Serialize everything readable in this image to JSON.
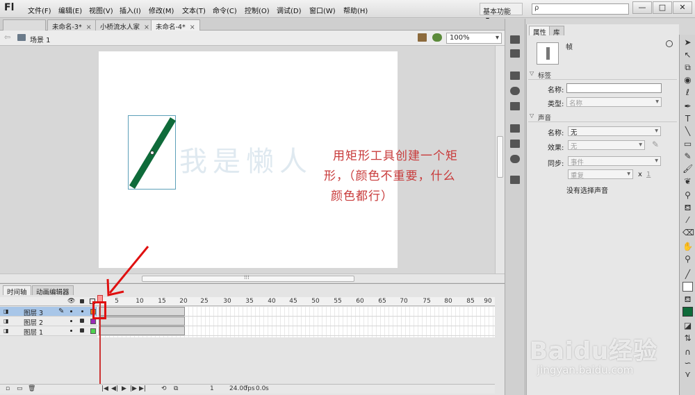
{
  "app": {
    "logo": "Fl"
  },
  "menu": [
    "文件(F)",
    "编辑(E)",
    "视图(V)",
    "插入(I)",
    "修改(M)",
    "文本(T)",
    "命令(C)",
    "控制(O)",
    "调试(D)",
    "窗口(W)",
    "帮助(H)"
  ],
  "workspace": {
    "label": "基本功能",
    "arrow": "▾"
  },
  "search": {
    "icon": "search-icon",
    "placeholder": "",
    "glyph": "ρ"
  },
  "window_controls": {
    "minimize": "—",
    "maximize": "□",
    "close": "✕"
  },
  "doc_tabs": [
    {
      "label": "未命名-3*",
      "close": "×"
    },
    {
      "label": "小桥流水人家",
      "close": "×"
    },
    {
      "label": "未命名-4*",
      "close": "×"
    }
  ],
  "edit_bar": {
    "back": "⇦",
    "scene_label": "场景 1",
    "zoom": "100%",
    "zoom_arrow": "▾"
  },
  "stage": {
    "watermark": "我是懒人",
    "annotation_lines": [
      "用矩形工具创建一个矩",
      "形，（颜色不重要，什么",
      "颜色都行）"
    ],
    "shape_color": "#0f6b3a",
    "hscroll_grip": "⁞⁞⁞"
  },
  "timeline": {
    "tabs": [
      "时间轴",
      "动画编辑器"
    ],
    "ruler": [
      1,
      5,
      10,
      15,
      20,
      25,
      30,
      35,
      40,
      45,
      50,
      55,
      60,
      65,
      70,
      75,
      80,
      85,
      90
    ],
    "layers": [
      {
        "name": "图层 3",
        "color": "#e07f1f",
        "selected": true
      },
      {
        "name": "图层 2",
        "color": "#9b2bb7",
        "selected": false
      },
      {
        "name": "图层 1",
        "color": "#4fd34f",
        "selected": false
      }
    ],
    "current_frame": "1",
    "fps": "24.00",
    "fps_unit": "fps",
    "time": "0.0",
    "time_unit": "s",
    "controls": [
      "|◀",
      "◀|",
      "▶",
      "|▶",
      "▶|",
      "⟲",
      "⧉"
    ]
  },
  "properties": {
    "tabs": [
      "属性",
      "库"
    ],
    "object_type": "帧",
    "sections": {
      "label": "标签",
      "sound": "声音"
    },
    "name_label": "名称:",
    "name_value": "",
    "type_label": "类型:",
    "type_value": "名称",
    "sound_name_label": "名称:",
    "sound_name_value": "无",
    "effect_label": "效果:",
    "effect_value": "无",
    "sync_label": "同步:",
    "sync_value": "事件",
    "repeat_value": "重复",
    "repeat_x": "x",
    "repeat_count": "1",
    "no_sound": "没有选择声音"
  },
  "baidu": {
    "logo": "Baidu经验",
    "url": "jingyan.baidu.com"
  },
  "colors": {
    "annotation": "#c83a3a",
    "highlight": "#e01010",
    "stroke_swatch": "#000000",
    "fill_swatch": "#0f6b3a"
  }
}
